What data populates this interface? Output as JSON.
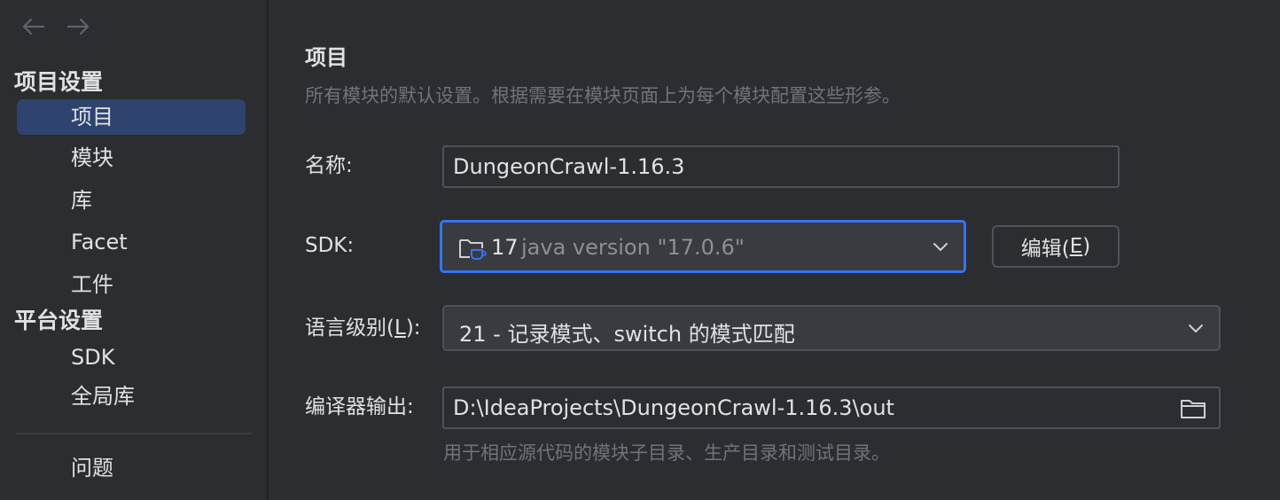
{
  "nav": {
    "back_icon": "arrow-left-icon",
    "forward_icon": "arrow-right-icon"
  },
  "sidebar": {
    "project_settings_title": "项目设置",
    "project_items": [
      {
        "label": "项目",
        "selected": true
      },
      {
        "label": "模块",
        "selected": false
      },
      {
        "label": "库",
        "selected": false
      },
      {
        "label": "Facet",
        "selected": false
      },
      {
        "label": "工件",
        "selected": false
      }
    ],
    "platform_settings_title": "平台设置",
    "platform_items": [
      {
        "label": "SDK"
      },
      {
        "label": "全局库"
      }
    ],
    "problems_label": "问题"
  },
  "main": {
    "title": "项目",
    "description": "所有模块的默认设置。根据需要在模块页面上为每个模块配置这些形参。",
    "name_label": "名称:",
    "name_value": "DungeonCrawl-1.16.3",
    "sdk_label": "SDK:",
    "sdk_icon": "java-folder-icon",
    "sdk_version": "17",
    "sdk_detail": "java version \"17.0.6\"",
    "edit_button_prefix": "编辑(",
    "edit_button_mnemonic": "E",
    "edit_button_suffix": ")",
    "language_level_label_prefix": "语言级别(",
    "language_level_label_mnemonic": "L",
    "language_level_label_suffix": "):",
    "language_level_value": "21 - 记录模式、switch 的模式匹配",
    "compiler_output_label": "编译器输出:",
    "compiler_output_value": "D:\\IdeaProjects\\DungeonCrawl-1.16.3\\out",
    "compiler_output_hint": "用于相应源代码的模块子目录、生产目录和测试目录。"
  },
  "colors": {
    "background": "#2b2d30",
    "selected_item": "#2e436e",
    "focus_border": "#3574f0",
    "field_border": "#4e5157",
    "hint_text": "#6f737a",
    "text": "#dfe1e5"
  }
}
